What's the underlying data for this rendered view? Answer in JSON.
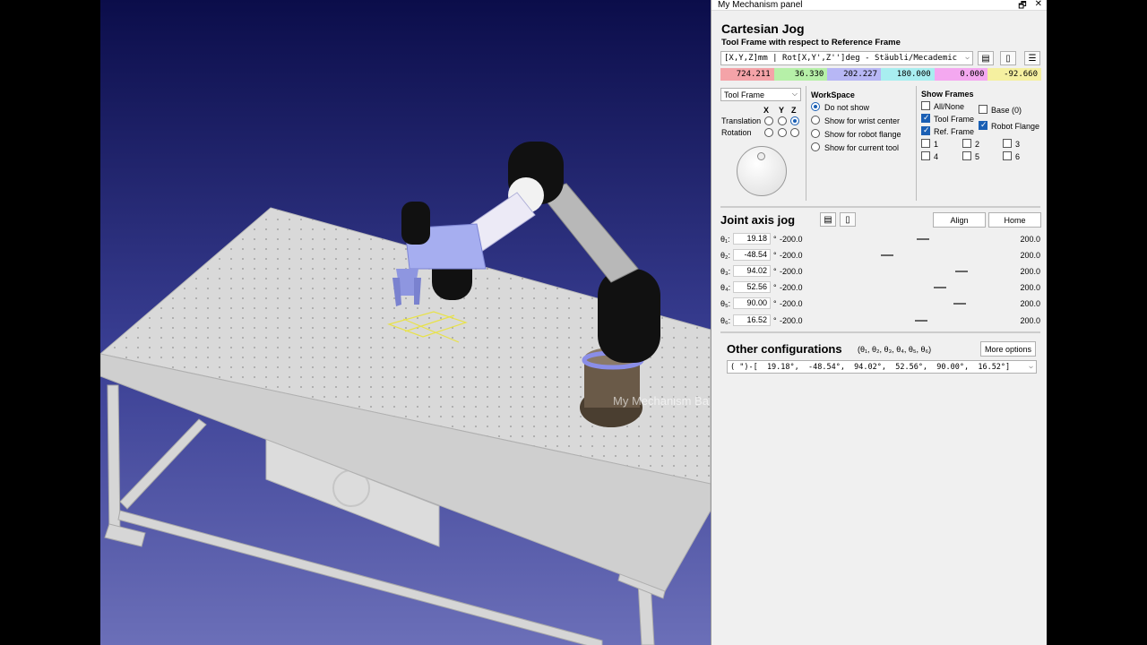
{
  "viewport": {
    "watermark": "My Mechanism Ba"
  },
  "panel": {
    "title": "My Mechanism panel",
    "restore_glyph": "🗗",
    "close_glyph": "✕",
    "cartesian": {
      "heading": "Cartesian Jog",
      "subheading": "Tool Frame with respect to Reference Frame",
      "format_select": "[X,Y,Z]mm | Rot[X,Y',Z'']deg - Stäubli/Mecademic",
      "values": [
        "724.211",
        "36.330",
        "202.227",
        "180.000",
        "0.000",
        "-92.660"
      ],
      "value_colors": [
        "#f4a3a8",
        "#b6f0a8",
        "#b7b7f5",
        "#a8eef0",
        "#f4a8f0",
        "#f5f0a0"
      ],
      "frame_select": "Tool Frame",
      "axes": [
        "X",
        "Y",
        "Z"
      ],
      "translation_label": "Translation",
      "rotation_label": "Rotation"
    },
    "workspace": {
      "heading": "WorkSpace",
      "options": [
        "Do not show",
        "Show for wrist center",
        "Show for robot flange",
        "Show for current tool"
      ],
      "selected": 0
    },
    "show_frames": {
      "heading": "Show Frames",
      "items": [
        {
          "label": "All/None",
          "checked": false
        },
        {
          "label": "Base (0)",
          "checked": false
        },
        {
          "label": "Tool Frame",
          "checked": true
        },
        {
          "label": "Robot Flange",
          "checked": true
        },
        {
          "label": "Ref. Frame",
          "checked": true
        },
        {
          "label": "1",
          "checked": false
        },
        {
          "label": "2",
          "checked": false
        },
        {
          "label": "3",
          "checked": false
        },
        {
          "label": "4",
          "checked": false
        },
        {
          "label": "5",
          "checked": false
        },
        {
          "label": "6",
          "checked": false
        }
      ]
    },
    "joint": {
      "heading": "Joint axis jog",
      "align_label": "Align",
      "home_label": "Home",
      "rows": [
        {
          "label": "θ₁:",
          "value": "19.18",
          "min": "-200.0",
          "max": "200.0",
          "fraction": 0.548
        },
        {
          "label": "θ₂:",
          "value": "-48.54",
          "min": "-200.0",
          "max": "200.0",
          "fraction": 0.379
        },
        {
          "label": "θ₃:",
          "value": "94.02",
          "min": "-200.0",
          "max": "200.0",
          "fraction": 0.735
        },
        {
          "label": "θ₄:",
          "value": "52.56",
          "min": "-200.0",
          "max": "200.0",
          "fraction": 0.631
        },
        {
          "label": "θ₅:",
          "value": "90.00",
          "min": "-200.0",
          "max": "200.0",
          "fraction": 0.725
        },
        {
          "label": "θ₆:",
          "value": "16.52",
          "min": "-200.0",
          "max": "200.0",
          "fraction": 0.541
        }
      ],
      "unit": "°"
    },
    "other": {
      "heading": "Other configurations",
      "theta_list": "(θ₁, θ₂, θ₃, θ₄, θ₅, θ₆)",
      "more_label": "More options",
      "config_value": "( \")-[  19.18°,  -48.54°,  94.02°,  52.56°,  90.00°,  16.52°]"
    }
  }
}
